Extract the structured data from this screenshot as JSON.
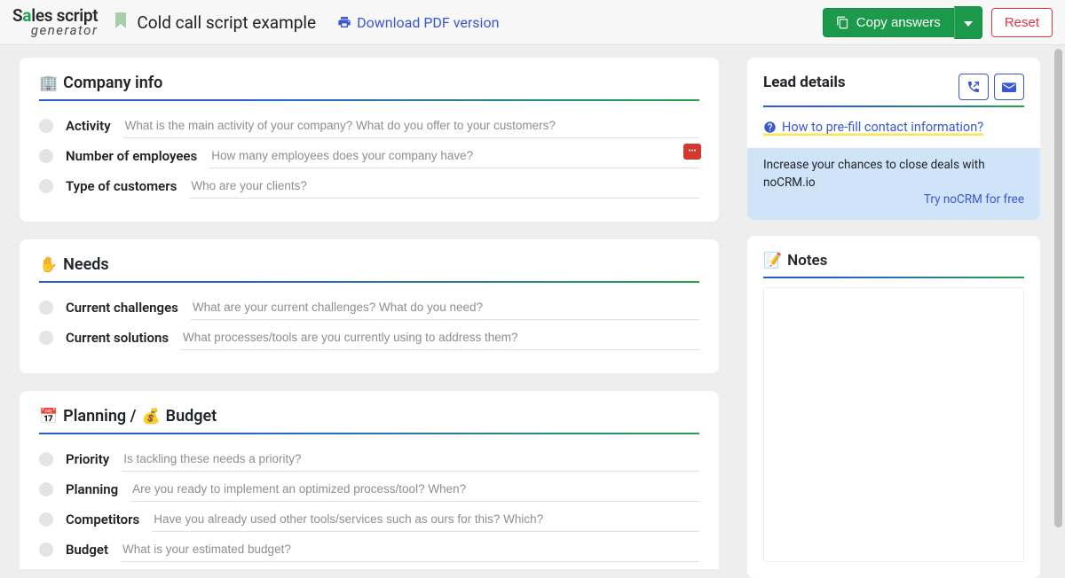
{
  "header": {
    "logo_top_left": "S",
    "logo_accent": "a",
    "logo_top_right": "les script",
    "logo_bottom": "generator",
    "title": "Cold call script example",
    "download_label": "Download PDF version",
    "copy_label": "Copy answers",
    "reset_label": "Reset"
  },
  "sections": [
    {
      "emoji": "🏢",
      "title": "Company info",
      "fields": [
        {
          "label": "Activity",
          "placeholder": "What is the main activity of your company? What do you offer to your customers?",
          "ext": false
        },
        {
          "label": "Number of employees",
          "placeholder": "How many employees does your company have?",
          "ext": true
        },
        {
          "label": "Type of customers",
          "placeholder": "Who are your clients?",
          "ext": false
        }
      ]
    },
    {
      "emoji": "✋",
      "title": "Needs",
      "fields": [
        {
          "label": "Current challenges",
          "placeholder": "What are your current challenges? What do you need?",
          "ext": false
        },
        {
          "label": "Current solutions",
          "placeholder": "What processes/tools are you currently using to address them?",
          "ext": false
        }
      ]
    },
    {
      "emoji": "📅",
      "title_prefix": "Planning / ",
      "emoji2": "💰 ",
      "title_suffix": "Budget",
      "fields": [
        {
          "label": "Priority",
          "placeholder": "Is tackling these needs a priority?",
          "ext": false
        },
        {
          "label": "Planning",
          "placeholder": "Are you ready to implement an optimized process/tool? When?",
          "ext": false
        },
        {
          "label": "Competitors",
          "placeholder": "Have you already used other tools/services such as ours for this? Which?",
          "ext": false
        },
        {
          "label": "Budget",
          "placeholder": "What is your estimated budget?",
          "ext": false
        }
      ]
    }
  ],
  "sidebar": {
    "lead_title": "Lead details",
    "help_link": "How to pre-fill contact information?",
    "promo_text": "Increase your chances to close deals with noCRM.io",
    "promo_link": "Try noCRM for free",
    "notes_emoji": "📝",
    "notes_title": "Notes"
  }
}
